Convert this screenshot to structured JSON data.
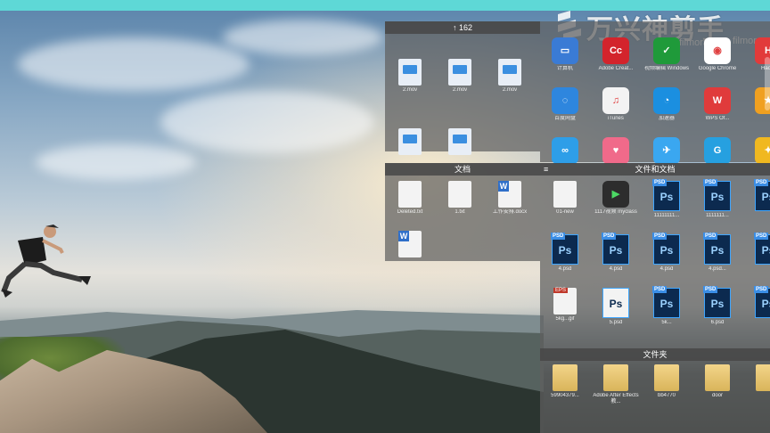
{
  "watermark": {
    "cn_text": "万兴神剪手",
    "brand": "filmora",
    "brand2": "filmora"
  },
  "fence_videos": {
    "header": "↑ 162",
    "items": [
      {
        "label": "2.mov",
        "icon": "video-file-icon"
      },
      {
        "label": "2.mov",
        "icon": "video-file-icon"
      },
      {
        "label": "2.mov",
        "icon": "video-file-icon"
      },
      {
        "label": "",
        "icon": "video-file-icon"
      },
      {
        "label": "",
        "icon": "video-file-icon"
      }
    ]
  },
  "fence_documents": {
    "header": "文档",
    "items": [
      {
        "label": "Deleted.txt",
        "icon": "blank-file-icon"
      },
      {
        "label": "1.txt",
        "icon": "blank-file-icon"
      },
      {
        "label": "工作安排.docx",
        "icon": "word-file-icon"
      },
      {
        "label": "",
        "icon": "word-file-icon"
      }
    ]
  },
  "fence_apps": {
    "items": [
      {
        "label": "计算机",
        "color": "#3a7bd5",
        "icon": "computer-icon",
        "glyph": "▭"
      },
      {
        "label": "Adobe Creat...",
        "color": "#d3242c",
        "icon": "adobe-cc-icon",
        "glyph": "Cc"
      },
      {
        "label": "视频编辑 Windows",
        "color": "#1f9a3a",
        "icon": "editor-icon",
        "glyph": "✓"
      },
      {
        "label": "Google Chrome",
        "color": "#ffffff",
        "icon": "chrome-icon",
        "glyph": "◉"
      },
      {
        "label": "Hao...",
        "color": "#e23a3a",
        "icon": "app-icon",
        "glyph": "H"
      },
      {
        "label": "百度网盘",
        "color": "#2e86de",
        "icon": "netdisk-icon",
        "glyph": "◌"
      },
      {
        "label": "iTunes",
        "color": "#f3f3f3",
        "icon": "itunes-icon",
        "glyph": "♫"
      },
      {
        "label": "加速器",
        "color": "#1b8fe0",
        "icon": "app-icon",
        "glyph": "◔"
      },
      {
        "label": "WPS Of...",
        "color": "#e03b3b",
        "icon": "wps-icon",
        "glyph": "W"
      },
      {
        "label": "",
        "color": "#f0a020",
        "icon": "app-icon",
        "glyph": "★"
      },
      {
        "label": "",
        "color": "#2e9ee8",
        "icon": "app-icon",
        "glyph": "∞"
      },
      {
        "label": "",
        "color": "#f06a8a",
        "icon": "app-icon",
        "glyph": "♥"
      },
      {
        "label": "",
        "color": "#3aa7f0",
        "icon": "app-icon",
        "glyph": "✈"
      },
      {
        "label": "",
        "color": "#26a0e0",
        "icon": "app-icon",
        "glyph": "G"
      },
      {
        "label": "",
        "color": "#f0b820",
        "icon": "app-icon",
        "glyph": "✦"
      }
    ]
  },
  "fence_files": {
    "header": "文件和文档",
    "items": [
      {
        "label": "01-new",
        "type": "blank"
      },
      {
        "label": "1117视频 myclass",
        "type": "app"
      },
      {
        "label": "11111111...",
        "type": "psd"
      },
      {
        "label": "1111111...",
        "type": "psd"
      },
      {
        "label": "",
        "type": "psd"
      },
      {
        "label": "4.psd",
        "type": "psd"
      },
      {
        "label": "4.psd",
        "type": "psd"
      },
      {
        "label": "4.psd",
        "type": "psd"
      },
      {
        "label": "4.psd...",
        "type": "psd"
      },
      {
        "label": "",
        "type": "psd"
      },
      {
        "label": "5kg...gif",
        "type": "eps"
      },
      {
        "label": "5.psd",
        "type": "psd-white"
      },
      {
        "label": "5k...",
        "type": "psd"
      },
      {
        "label": "6.psd",
        "type": "psd"
      },
      {
        "label": "",
        "type": "psd"
      }
    ]
  },
  "fence_folders": {
    "header": "文件夹",
    "items": [
      {
        "label": "59904379...",
        "type": "folder"
      },
      {
        "label": "Adobe After Effects 教...",
        "type": "folder"
      },
      {
        "label": "bb4770",
        "type": "folder"
      },
      {
        "label": "door",
        "type": "folder"
      },
      {
        "label": "",
        "type": "folder"
      }
    ]
  }
}
